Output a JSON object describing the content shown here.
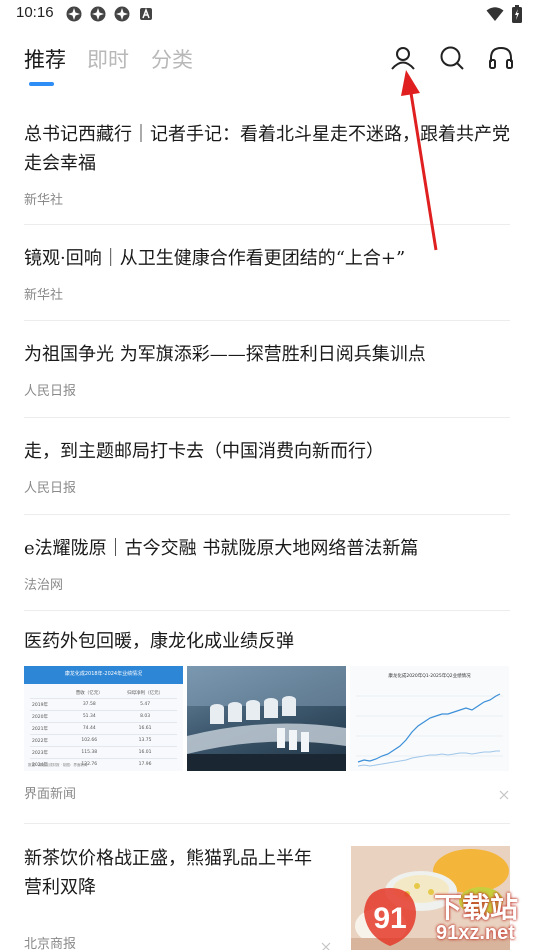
{
  "status": {
    "time": "10:16"
  },
  "tabs": [
    {
      "label": "推荐"
    },
    {
      "label": "即时"
    },
    {
      "label": "分类"
    }
  ],
  "header_icons": [
    "user-icon",
    "search-icon",
    "headphones-icon"
  ],
  "news": [
    {
      "title": "总书记西藏行｜记者手记：看着北斗星走不迷路，跟着共产党走会幸福",
      "source": "新华社"
    },
    {
      "title": "镜观·回响｜从卫生健康合作看更团结的“上合+”",
      "source": "新华社"
    },
    {
      "title": "为祖国争光 为军旗添彩——探营胜利日阅兵集训点",
      "source": "人民日报"
    },
    {
      "title": "走，到主题邮局打卡去（中国消费向新而行）",
      "source": "人民日报"
    },
    {
      "title": "e法耀陇原｜古今交融 书就陇原大地网络普法新篇",
      "source": "法治网"
    },
    {
      "title": "医药外包回暖，康龙化成业绩反弹",
      "source": "界面新闻",
      "thumb_table_title": "康龙化成2018年-2024年业绩情况",
      "thumb_table_headers": [
        "营收（亿元）",
        "归母净利（亿元）"
      ],
      "thumb_table_rows": [
        [
          "2019年",
          "37.58",
          "5.47"
        ],
        [
          "2020年",
          "51.34",
          "8.03"
        ],
        [
          "2021年",
          "74.44",
          "16.61"
        ],
        [
          "2022年",
          "102.66",
          "13.75"
        ],
        [
          "2023年",
          "115.38",
          "16.01"
        ],
        [
          "2024年",
          "122.76",
          "17.96"
        ]
      ],
      "thumb_table_note": "数据：康龙化成财报 · 制图：界面新闻",
      "thumb_chart_title": "康龙化成2020年Q1-2025年Q2业绩情况"
    },
    {
      "title": "新茶饮价格战正盛，熊猫乳品上半年营利双降",
      "source": "北京商报"
    }
  ],
  "watermark": {
    "text": "下载站",
    "url": "91xz.net"
  }
}
